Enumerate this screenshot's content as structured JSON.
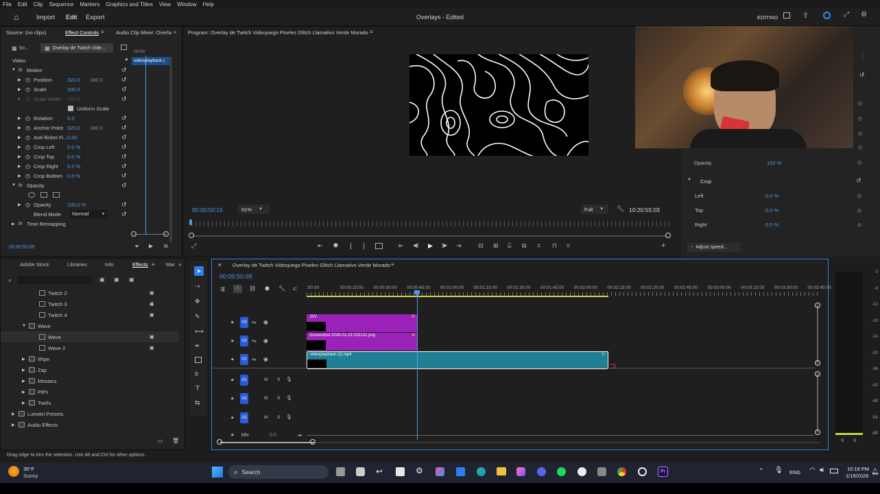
{
  "menu": [
    "File",
    "Edit",
    "Clip",
    "Sequence",
    "Markers",
    "Graphics and Titles",
    "View",
    "Window",
    "Help"
  ],
  "header": {
    "tabs": [
      "Import",
      "Edit",
      "Export"
    ],
    "title": "Overlays - Edited",
    "workspace": "EDITING"
  },
  "effect_controls": {
    "tabs": [
      "Source: (no clips)",
      "Effect Controls",
      "Audio Clip Mixer: Overla"
    ],
    "source_short": "So...",
    "clip_name": "Overlay de Twitch Vide...",
    "timeline_clip_label": "videoplayback (",
    "timeline_time": "00:00",
    "section_video": "Video",
    "properties": [
      {
        "name": "Motion",
        "value1": "",
        "value2": "",
        "type": "fx"
      },
      {
        "name": "Position",
        "value1": "320.0",
        "value2": "180.0",
        "type": "prop"
      },
      {
        "name": "Scale",
        "value1": "100.0",
        "value2": "",
        "type": "prop"
      },
      {
        "name": "Scale Width",
        "value1": "100.0",
        "value2": "",
        "type": "dim"
      },
      {
        "name": "Uniform Scale",
        "value1": "",
        "value2": "",
        "type": "check"
      },
      {
        "name": "Rotation",
        "value1": "0.0",
        "value2": "",
        "type": "prop"
      },
      {
        "name": "Anchor Point",
        "value1": "320.0",
        "value2": "180.0",
        "type": "prop"
      },
      {
        "name": "Anti-flicker Fi...",
        "value1": "0.00",
        "value2": "",
        "type": "prop"
      },
      {
        "name": "Crop Left",
        "value1": "0.0 %",
        "value2": "",
        "type": "prop"
      },
      {
        "name": "Crop Top",
        "value1": "0.0 %",
        "value2": "",
        "type": "prop"
      },
      {
        "name": "Crop Right",
        "value1": "0.0 %",
        "value2": "",
        "type": "prop"
      },
      {
        "name": "Crop Bottom",
        "value1": "0.0 %",
        "value2": "",
        "type": "prop"
      },
      {
        "name": "Opacity",
        "value1": "",
        "value2": "",
        "type": "fx"
      },
      {
        "name": "",
        "value1": "",
        "value2": "",
        "type": "masks"
      },
      {
        "name": "Opacity",
        "value1": "100.0 %",
        "value2": "",
        "type": "prop"
      },
      {
        "name": "Blend Mode",
        "value1": "Normal",
        "value2": "",
        "type": "select"
      },
      {
        "name": "Time Remapping",
        "value1": "",
        "value2": "",
        "type": "fx2"
      }
    ],
    "current_time": "00:00:50:09"
  },
  "program": {
    "title": "Program: Overlay de Twitch Videojuego Pixeles Glitch Llamativo Verde Morado",
    "timecode": "00:00:50:15",
    "zoom": "61%",
    "quality": "Full",
    "duration": "10:20:55:03"
  },
  "right_panel": {
    "opacity_label": "Opacity",
    "opacity_value": "100 %",
    "crop_label": "Crop",
    "crop_rows": [
      {
        "label": "Left",
        "value": "0.0 %"
      },
      {
        "label": "Top",
        "value": "0.0 %"
      },
      {
        "label": "Right",
        "value": "0.0 %"
      }
    ],
    "adjust_speed": "Adjust speed..."
  },
  "effects_panel": {
    "tabs": [
      "Adobe Stock",
      "Libraries",
      "Info",
      "Effects",
      "Mar"
    ],
    "items": [
      {
        "label": "Twitch 2",
        "indent": 2,
        "kind": "preset"
      },
      {
        "label": "Twitch 3",
        "indent": 2,
        "kind": "preset"
      },
      {
        "label": "Twitch 4",
        "indent": 2,
        "kind": "preset"
      },
      {
        "label": "Wave",
        "indent": 1,
        "kind": "folder-open"
      },
      {
        "label": "Wave",
        "indent": 2,
        "kind": "preset"
      },
      {
        "label": "Wave 2",
        "indent": 2,
        "kind": "preset"
      },
      {
        "label": "Wipe",
        "indent": 1,
        "kind": "folder"
      },
      {
        "label": "Zap",
        "indent": 1,
        "kind": "folder"
      },
      {
        "label": "Mosaics",
        "indent": 1,
        "kind": "folder"
      },
      {
        "label": "PiPs",
        "indent": 1,
        "kind": "folder"
      },
      {
        "label": "Twirls",
        "indent": 1,
        "kind": "folder"
      },
      {
        "label": "Lumetri Presets",
        "indent": 0,
        "kind": "folder"
      },
      {
        "label": "Audio Effects",
        "indent": 0,
        "kind": "folder"
      }
    ]
  },
  "timeline": {
    "title": "Overlay de Twitch Videojuego Pixeles Glitch Llamativo Verde Morado",
    "timecode": "00:00:50:09",
    "ruler": [
      ":00:00",
      "00:00:15:00",
      "00:00:30:00",
      "00:00:45:00",
      "00:01:00:00",
      "00:01:15:00",
      "00:01:30:00",
      "00:01:45:00",
      "00:02:00:00",
      "00:02:15:00",
      "00:02:30:00",
      "00:02:45:00",
      "00:03:00:00",
      "00:03:15:00",
      "00:03:30:00",
      "00:03:45:00"
    ],
    "tracks_video": [
      "V3",
      "V2",
      "V1"
    ],
    "tracks_audio": [
      "A1",
      "A2",
      "A3"
    ],
    "mix_label": "Mix",
    "mix_value": "0.0",
    "clips": [
      {
        "name": "JSV",
        "track": "V3"
      },
      {
        "name": "Screenshot 2026-01-19 215131.png",
        "track": "V2"
      },
      {
        "name": "videoplayback (2).mp4",
        "track": "V1"
      }
    ]
  },
  "meter": {
    "ticks": [
      "0",
      "-6",
      "-12",
      "-18",
      "-24",
      "-30",
      "-36",
      "-42",
      "-48",
      "-54",
      "dB"
    ],
    "bottom": [
      "S",
      "S"
    ]
  },
  "status_text": "Drag edge to trim the selection. Use Alt and Ctrl for other options.",
  "taskbar": {
    "weather_temp": "35°F",
    "weather_desc": "Sunny",
    "search": "Search",
    "lang": "ENG",
    "time": "10:18 PM",
    "date": "1/19/2026"
  },
  "colors": {
    "accent": "#2f7cf6",
    "clip_purple": "#9b22b8",
    "clip_teal": "#1f7f95",
    "playhead": "#4b9ce8"
  }
}
